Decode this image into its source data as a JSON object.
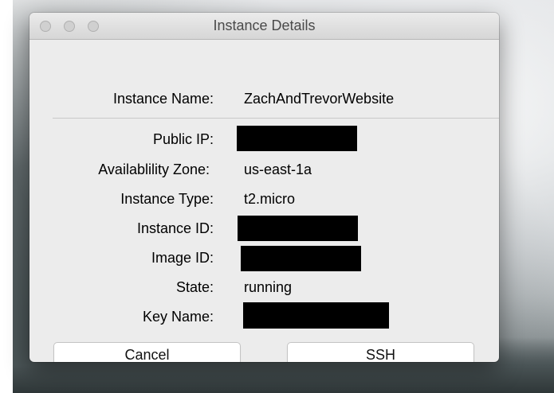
{
  "window": {
    "title": "Instance Details"
  },
  "fields": {
    "instance_name": {
      "label": "Instance Name:",
      "value": "ZachAndTrevorWebsite"
    },
    "public_ip": {
      "label": "Public IP:",
      "value": ""
    },
    "availability_zone": {
      "label": "Availablility Zone:",
      "value": "us-east-1a"
    },
    "instance_type": {
      "label": "Instance Type:",
      "value": "t2.micro"
    },
    "instance_id": {
      "label": "Instance ID:",
      "value": ""
    },
    "image_id": {
      "label": "Image ID:",
      "value": ""
    },
    "state": {
      "label": "State:",
      "value": "running"
    },
    "key_name": {
      "label": "Key Name:",
      "value": ""
    }
  },
  "buttons": {
    "cancel": "Cancel",
    "ssh": "SSH"
  },
  "colors": {
    "redaction": "#000000",
    "window_bg": "#ececec"
  }
}
